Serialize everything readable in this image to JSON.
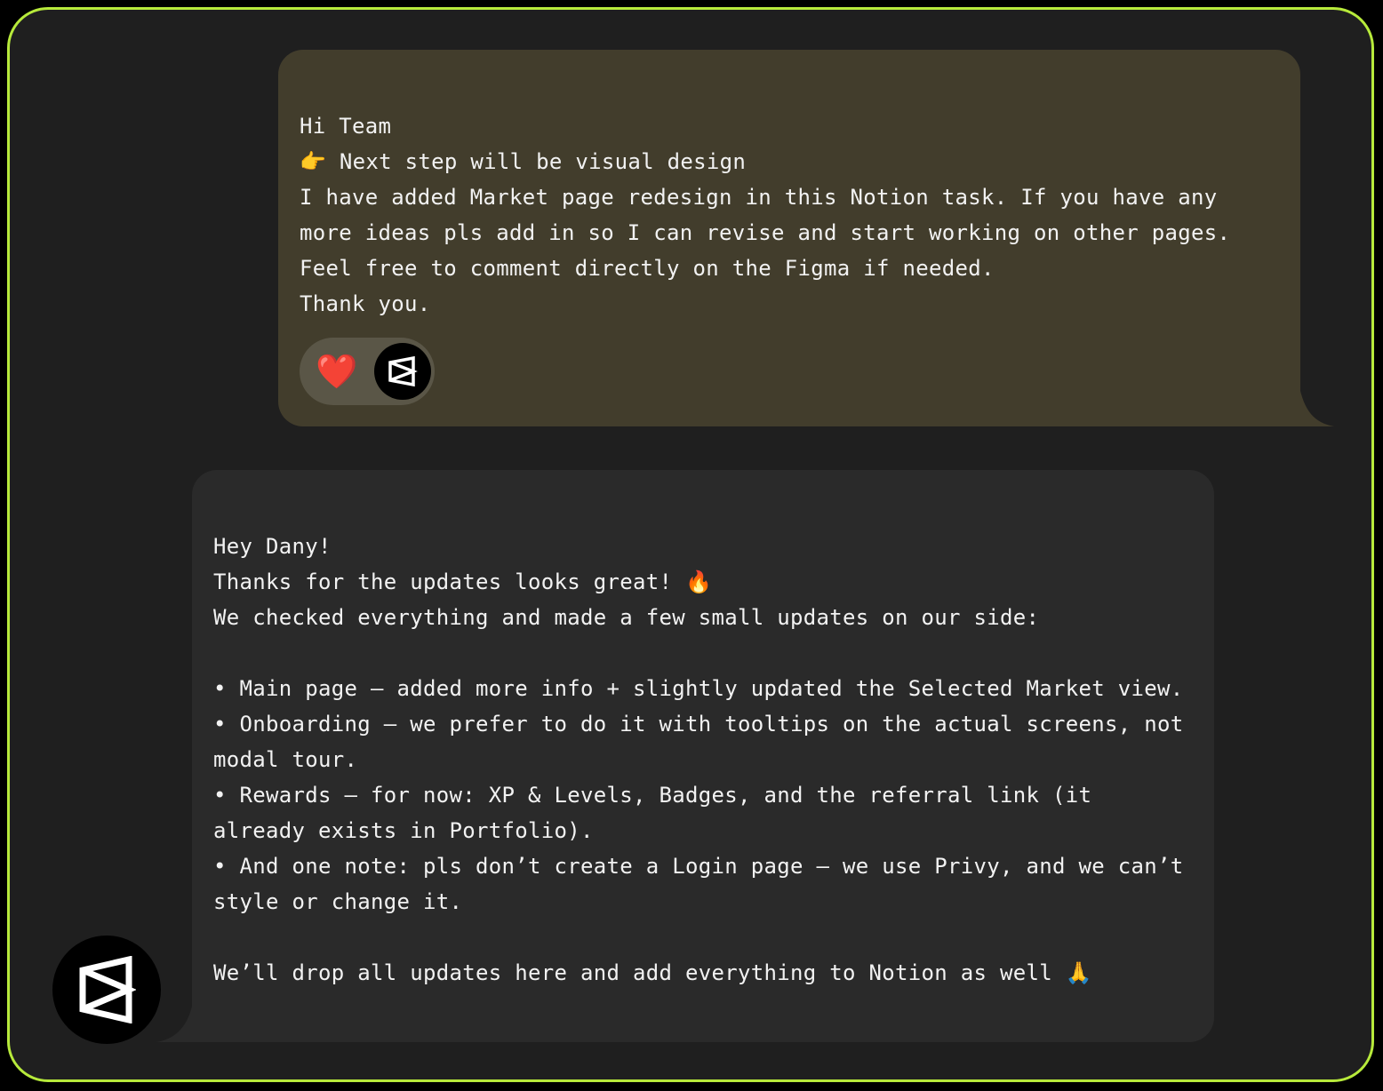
{
  "messages": {
    "outgoing": {
      "lines": [
        "Hi Team",
        "👉 Next step will be visual design",
        "I have added Market page redesign in this Notion task. If you have any more ideas pls add in so I can revise and start working on other pages.",
        "Feel free to comment directly on the Figma if needed.",
        "Thank you."
      ],
      "reactions": [
        "heart-emoji",
        "brand-logo-avatar"
      ],
      "heart": "❤️",
      "bubble_color": "#423d2c"
    },
    "incoming": {
      "lines": [
        "Hey Dany!",
        "Thanks for the updates looks great! 🔥",
        "We checked everything and made a few small updates on our side:",
        "",
        "• Main page — added more info + slightly updated the Selected Market view.",
        "• Onboarding — we prefer to do it with tooltips on the actual screens, not modal tour.",
        "• Rewards — for now: XP & Levels, Badges, and the referral link (it already exists in Portfolio).",
        "• And one note: pls don’t create a Login page — we use Privy, and we can’t style or change it.",
        "",
        "We’ll drop all updates here and add everything to Notion as well 🙏"
      ],
      "sender_avatar": "brand-logo-icon",
      "bubble_color": "#2a2a2a"
    }
  },
  "theme": {
    "border": "#b7ea3b",
    "background": "#1f1f1f"
  }
}
